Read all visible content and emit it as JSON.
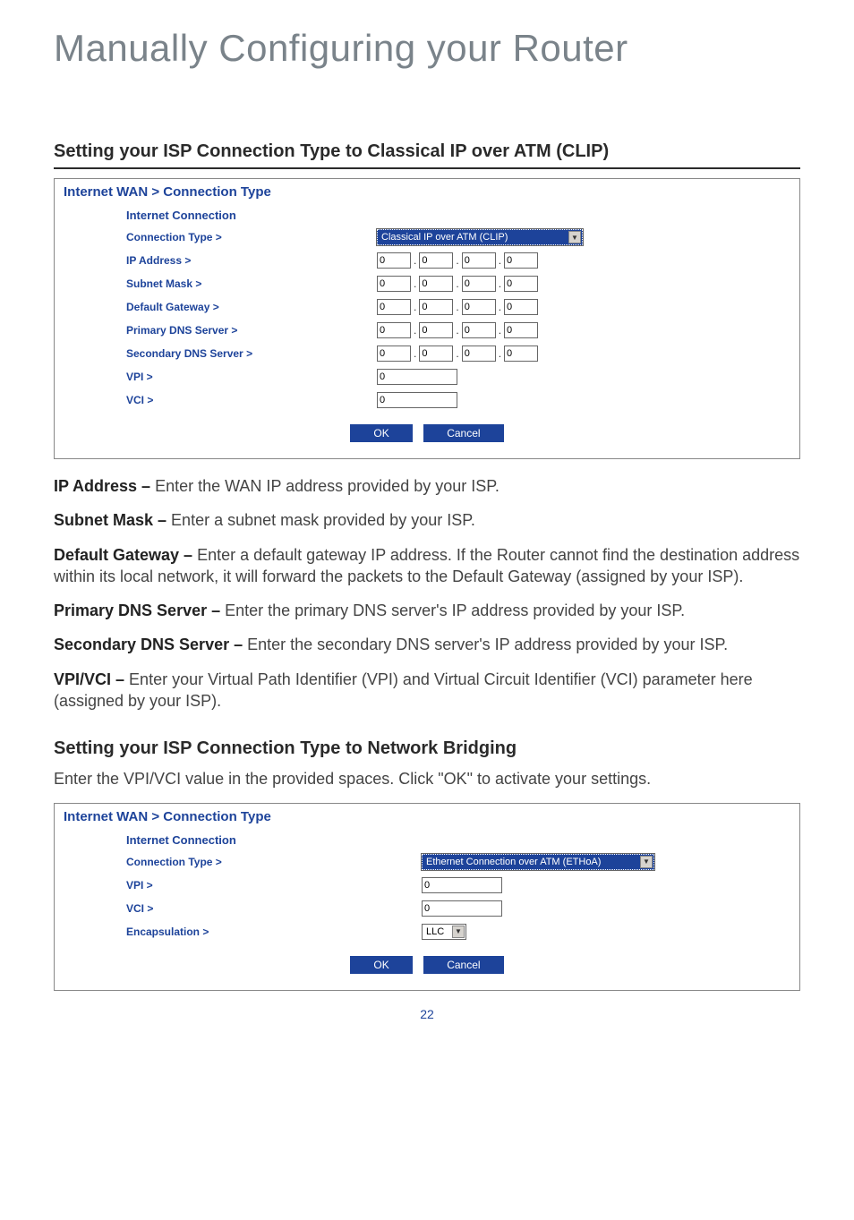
{
  "page_title": "Manually Configuring your Router",
  "heading1": "Setting your ISP Connection Type to Classical IP over ATM (CLIP)",
  "panel1": {
    "breadcrumb": "Internet WAN > Connection Type",
    "sub_head": "Internet Connection",
    "rows": {
      "conn_label": "Connection Type >",
      "conn_value": "Classical IP over ATM (CLIP)",
      "ip_label": "IP Address >",
      "subnet_label": "Subnet Mask >",
      "gateway_label": "Default Gateway >",
      "pdns_label": "Primary DNS Server >",
      "sdns_label": "Secondary DNS Server >",
      "vpi_label": "VPI >",
      "vci_label": "VCI >",
      "zero": "0"
    },
    "ok": "OK",
    "cancel": "Cancel"
  },
  "descriptions": [
    {
      "term": "IP Address – ",
      "text": "Enter the WAN IP address provided by your ISP."
    },
    {
      "term": "Subnet Mask – ",
      "text": "Enter a subnet mask provided by your ISP."
    },
    {
      "term": "Default Gateway – ",
      "text": "Enter a default gateway IP address. If the Router cannot find the destination address within its local network, it will forward the packets to the Default Gateway (assigned by your ISP)."
    },
    {
      "term": "Primary DNS Server – ",
      "text": "Enter the primary DNS server's IP address provided by your ISP."
    },
    {
      "term": "Secondary DNS Server – ",
      "text": "Enter the secondary DNS server's IP address provided by your ISP."
    },
    {
      "term": "VPI/VCI – ",
      "text": "Enter your Virtual Path Identifier (VPI) and Virtual Circuit Identifier (VCI) parameter here (assigned by your ISP)."
    }
  ],
  "heading2": "Setting your ISP Connection Type to Network Bridging",
  "para2": "Enter the VPI/VCI value in the provided spaces. Click \"OK\" to activate your settings.",
  "panel2": {
    "breadcrumb": "Internet WAN > Connection Type",
    "sub_head": "Internet Connection",
    "rows": {
      "conn_label": "Connection Type >",
      "conn_value": "Ethernet Connection over ATM (ETHoA)",
      "vpi_label": "VPI >",
      "vci_label": "VCI >",
      "encap_label": "Encapsulation >",
      "encap_value": "LLC",
      "zero": "0"
    },
    "ok": "OK",
    "cancel": "Cancel"
  },
  "page_number": "22"
}
